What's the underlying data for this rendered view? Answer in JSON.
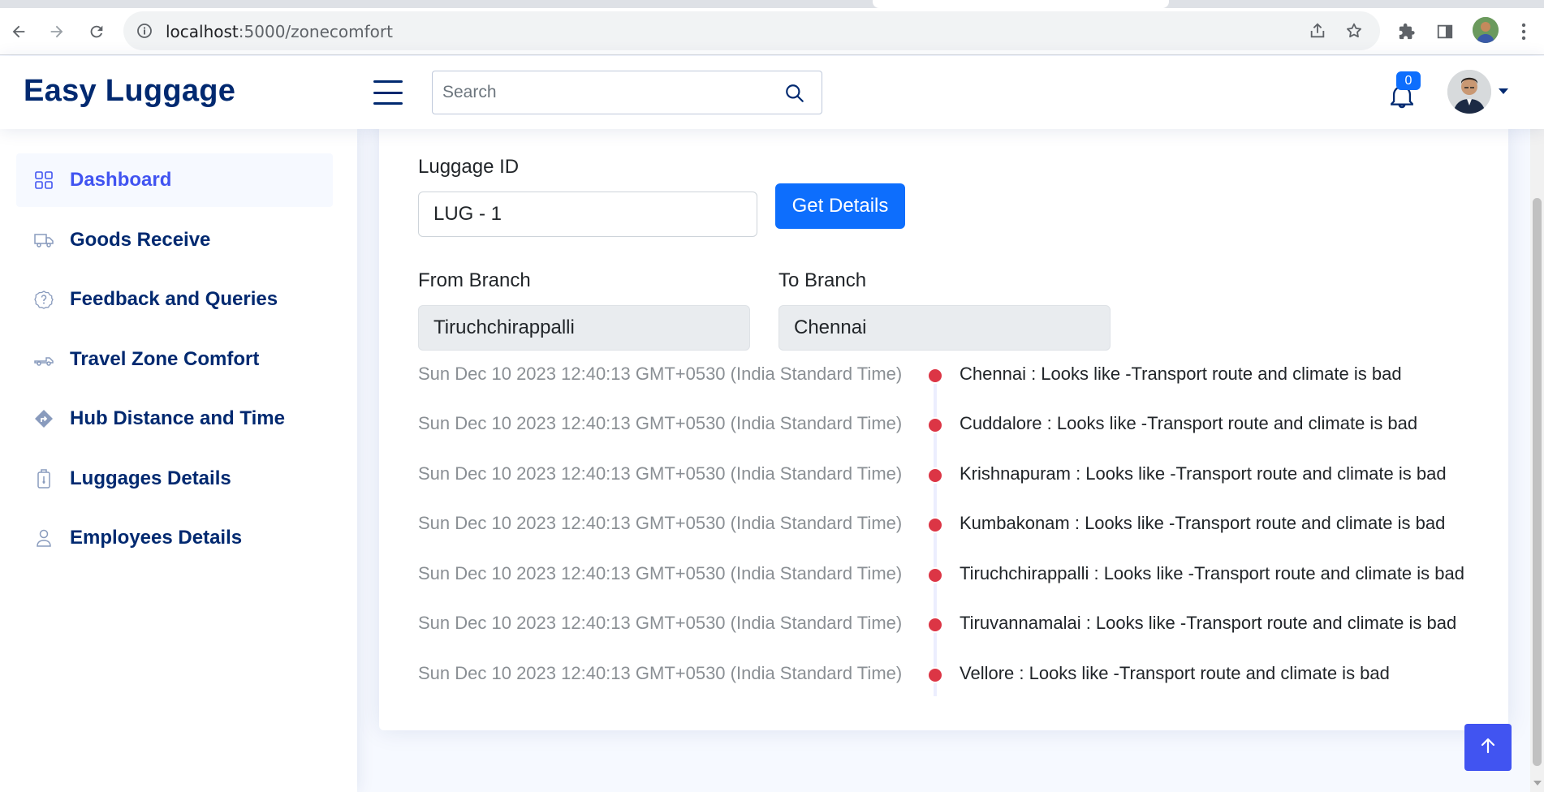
{
  "browser": {
    "url_host": "localhost",
    "url_path": ":5000/zonecomfort"
  },
  "header": {
    "logo": "Easy Luggage",
    "search_placeholder": "Search",
    "notification_count": "0"
  },
  "sidebar": {
    "items": [
      {
        "label": "Dashboard",
        "icon": "grid-icon",
        "active": true
      },
      {
        "label": "Goods Receive",
        "icon": "truck-icon",
        "active": false
      },
      {
        "label": "Feedback and Queries",
        "icon": "question-circle-icon",
        "active": false
      },
      {
        "label": "Travel Zone Comfort",
        "icon": "truck-flatbed-icon",
        "active": false
      },
      {
        "label": "Hub Distance and Time",
        "icon": "sign-turn-right-icon",
        "active": false
      },
      {
        "label": "Luggages Details",
        "icon": "luggage-icon",
        "active": false
      },
      {
        "label": "Employees Details",
        "icon": "person-icon",
        "active": false
      }
    ]
  },
  "form": {
    "luggage_id_label": "Luggage ID",
    "luggage_id_value": "LUG - 1",
    "get_details_label": "Get Details",
    "from_branch_label": "From Branch",
    "from_branch_value": "Tiruchchirappalli",
    "to_branch_label": "To Branch",
    "to_branch_value": "Chennai"
  },
  "timeline": [
    {
      "time": "Sun Dec 10 2023 12:40:13 GMT+0530 (India Standard Time)",
      "text": "Chennai : Looks like -Transport route and climate is bad"
    },
    {
      "time": "Sun Dec 10 2023 12:40:13 GMT+0530 (India Standard Time)",
      "text": "Cuddalore : Looks like -Transport route and climate is bad"
    },
    {
      "time": "Sun Dec 10 2023 12:40:13 GMT+0530 (India Standard Time)",
      "text": "Krishnapuram : Looks like -Transport route and climate is bad"
    },
    {
      "time": "Sun Dec 10 2023 12:40:13 GMT+0530 (India Standard Time)",
      "text": "Kumbakonam : Looks like -Transport route and climate is bad"
    },
    {
      "time": "Sun Dec 10 2023 12:40:13 GMT+0530 (India Standard Time)",
      "text": "Tiruchchirappalli : Looks like -Transport route and climate is bad"
    },
    {
      "time": "Sun Dec 10 2023 12:40:13 GMT+0530 (India Standard Time)",
      "text": "Tiruvannamalai : Looks like -Transport route and climate is bad"
    },
    {
      "time": "Sun Dec 10 2023 12:40:13 GMT+0530 (India Standard Time)",
      "text": "Vellore : Looks like -Transport route and climate is bad"
    }
  ],
  "colors": {
    "brand": "#012970",
    "accent": "#4154f1",
    "primary_button": "#0d6efd",
    "timeline_dot": "#dc3545"
  }
}
